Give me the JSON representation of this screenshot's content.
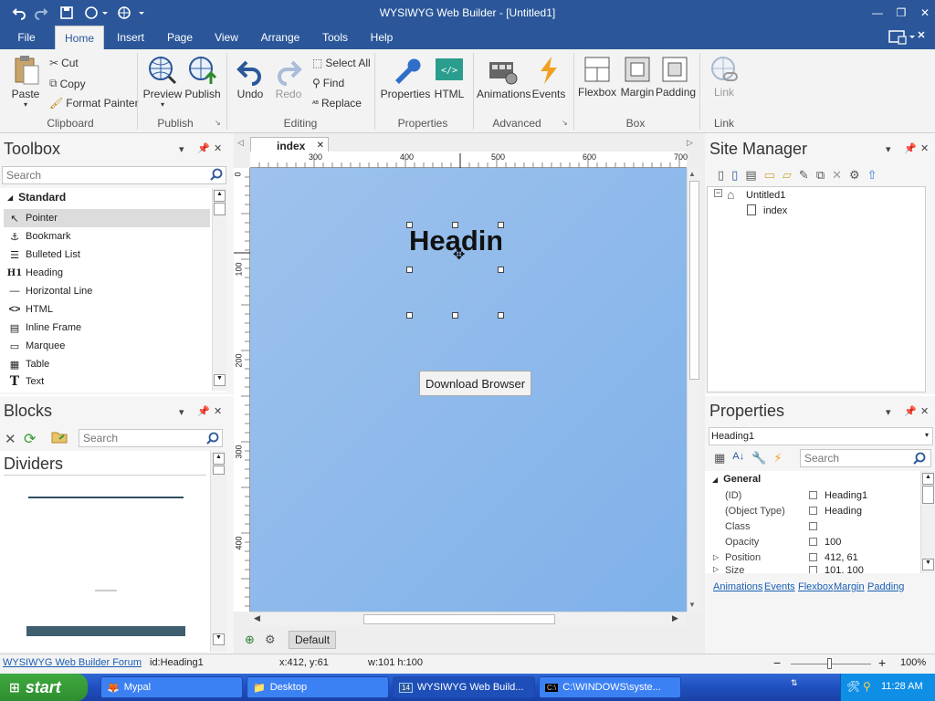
{
  "window": {
    "title": "WYSIWYG Web Builder - [Untitled1]"
  },
  "tabs": [
    "File",
    "Home",
    "Insert",
    "Page",
    "View",
    "Arrange",
    "Tools",
    "Help"
  ],
  "ribbon": {
    "clipboard": {
      "paste": "Paste",
      "cut": "Cut",
      "copy": "Copy",
      "format_painter": "Format Painter",
      "label": "Clipboard"
    },
    "publish": {
      "preview": "Preview",
      "publish": "Publish",
      "label": "Publish"
    },
    "editing": {
      "undo": "Undo",
      "redo": "Redo",
      "select_all": "Select All",
      "find": "Find",
      "replace": "Replace",
      "label": "Editing"
    },
    "properties": {
      "properties": "Properties",
      "html": "HTML",
      "label": "Properties"
    },
    "advanced": {
      "animations": "Animations",
      "events": "Events",
      "label": "Advanced"
    },
    "box": {
      "flexbox": "Flexbox",
      "margin": "Margin",
      "padding": "Padding",
      "label": "Box"
    },
    "link": {
      "link": "Link",
      "label": "Link"
    }
  },
  "toolbox": {
    "title": "Toolbox",
    "search_placeholder": "Search",
    "category": "Standard",
    "items": [
      "Pointer",
      "Bookmark",
      "Bulleted List",
      "Heading",
      "Horizontal Line",
      "HTML",
      "Inline Frame",
      "Marquee",
      "Table",
      "Text"
    ]
  },
  "blocks": {
    "title": "Blocks",
    "search_placeholder": "Search",
    "section": "Dividers"
  },
  "document": {
    "tab": "index",
    "ruler": [
      "300",
      "400",
      "500",
      "600",
      "700"
    ],
    "vruler": [
      "0",
      "100",
      "200",
      "300",
      "400"
    ],
    "heading_text": "Headin",
    "button_text": "Download Browser",
    "layout_default": "Default"
  },
  "site_manager": {
    "title": "Site Manager",
    "root": "Untitled1",
    "page": "index"
  },
  "properties": {
    "title": "Properties",
    "selected": "Heading1",
    "search_placeholder": "Search",
    "section": "General",
    "rows": [
      {
        "k": "(ID)",
        "v": "Heading1"
      },
      {
        "k": "(Object Type)",
        "v": "Heading"
      },
      {
        "k": "Class",
        "v": ""
      },
      {
        "k": "Opacity",
        "v": "100"
      },
      {
        "k": "Position",
        "v": "412, 61"
      },
      {
        "k": "Size",
        "v": "101, 100"
      }
    ],
    "links": [
      "Animations",
      "Events",
      "Flexbox",
      "Margin",
      "Padding"
    ]
  },
  "status": {
    "forum": "WYSIWYG Web Builder Forum",
    "id": "id:Heading1",
    "pos": "x:412, y:61",
    "size": "w:101 h:100",
    "zoom": "100%"
  },
  "taskbar": {
    "start": "start",
    "tasks": [
      "Mypal",
      "Desktop",
      "WYSIWYG Web Build...",
      "C:\\WINDOWS\\syste..."
    ],
    "clock": "11:28 AM"
  },
  "colors": {
    "accent": "#2b579a",
    "canvas": "#8fb9ec",
    "taskbar": "#245edb"
  }
}
